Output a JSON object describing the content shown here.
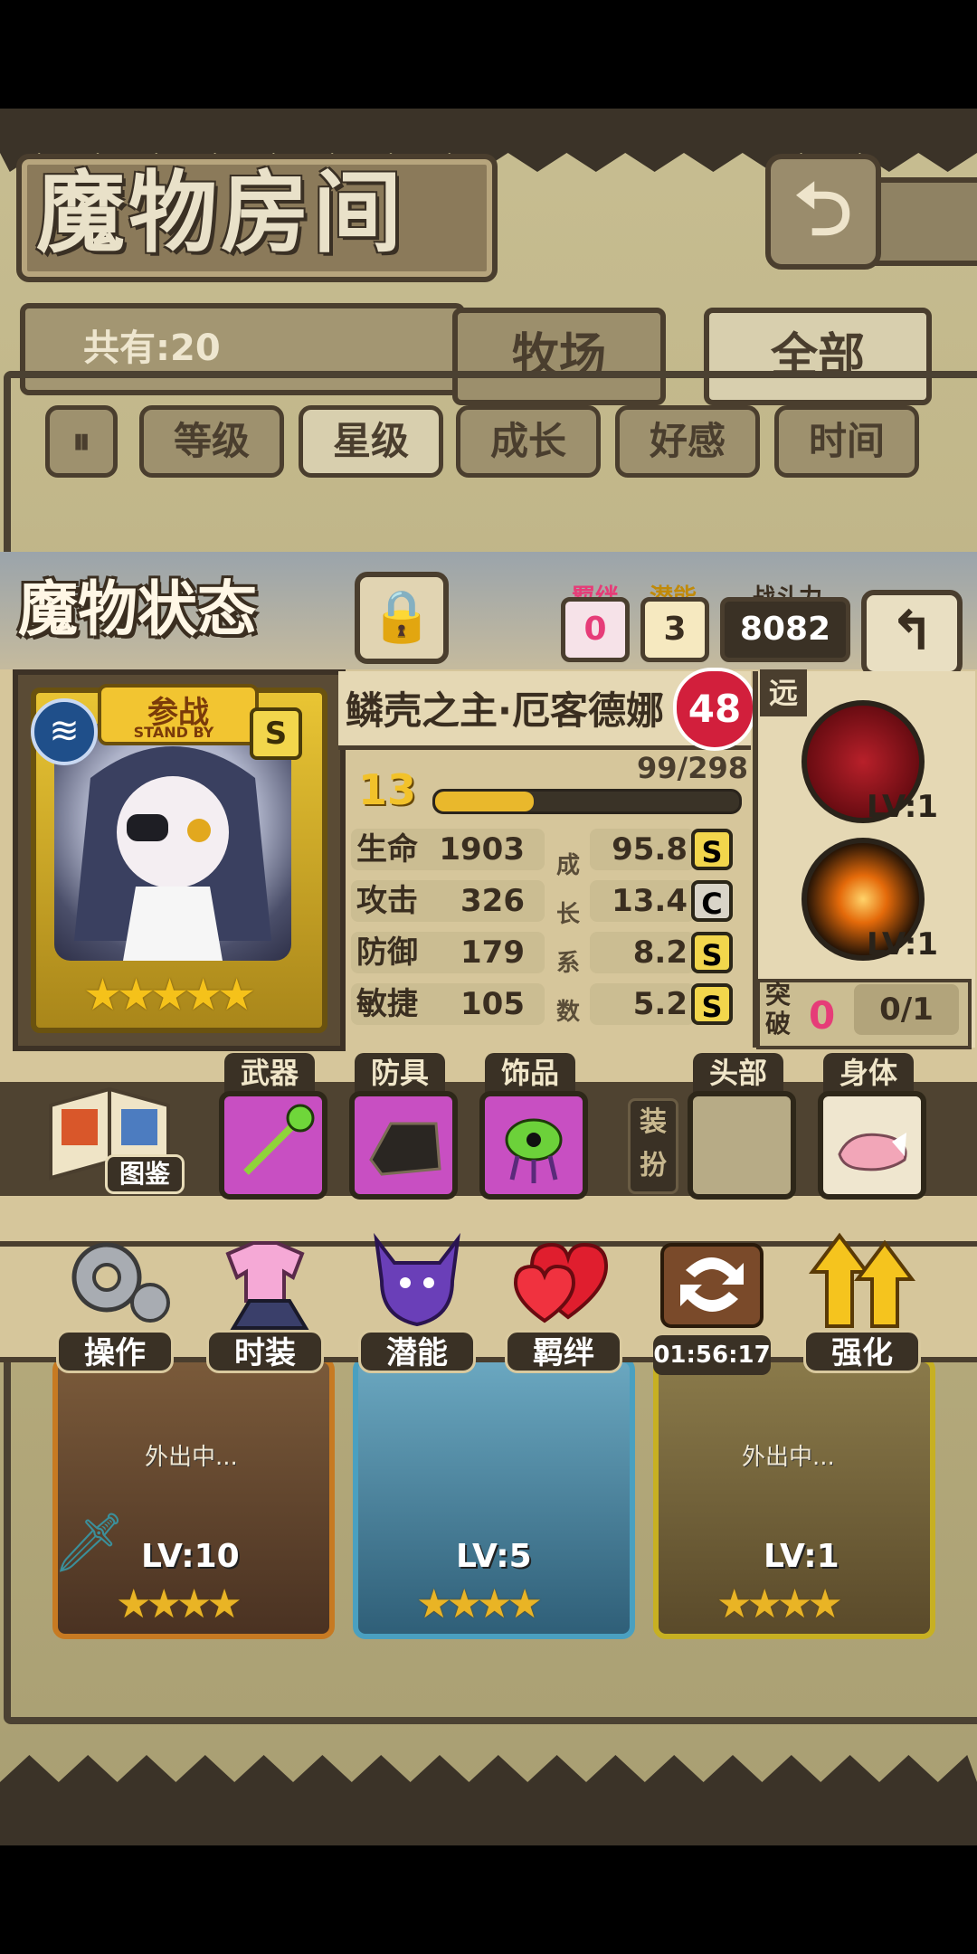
{
  "header": {
    "title": "魔物房间",
    "count_text": "共有:20",
    "tabs": [
      "牧场",
      "全部"
    ]
  },
  "sort": {
    "icon": "sort-toggle-icon",
    "buttons": [
      "等级",
      "星级",
      "成长",
      "好感",
      "时间"
    ],
    "active": "星级"
  },
  "status": {
    "title": "魔物状态",
    "bond": {
      "label": "羁绊",
      "value": "0"
    },
    "potential": {
      "label": "潜能",
      "value": "3"
    },
    "power": {
      "label": "战斗力",
      "value": "8082"
    }
  },
  "card": {
    "standby_cn": "参战",
    "standby_en": "STAND BY",
    "rank": "S",
    "stars": 5
  },
  "monster": {
    "name": "鳞壳之主·厄客德娜",
    "level": "48",
    "star_level": "13",
    "exp_text": "99/298",
    "exp_fraction": 0.33,
    "stats": [
      {
        "label": "生命",
        "value": "1903",
        "growth": "95.8",
        "grade": "S"
      },
      {
        "label": "攻击",
        "value": "326",
        "growth": "13.4",
        "grade": "C"
      },
      {
        "label": "防御",
        "value": "179",
        "growth": "8.2",
        "grade": "S"
      },
      {
        "label": "敏捷",
        "value": "105",
        "growth": "5.2",
        "grade": "S"
      }
    ],
    "growth_label": [
      "成",
      "长",
      "系",
      "数"
    ]
  },
  "skills": {
    "range": "远",
    "items": [
      {
        "icon": "serpent-skill-icon",
        "lv": "LV:1"
      },
      {
        "icon": "burst-skill-icon",
        "lv": "LV:1"
      }
    ],
    "breakthrough_label": "突破",
    "breakthrough_count": "0",
    "breakthrough_progress": "0/1"
  },
  "equipment": {
    "book_label": "图鉴",
    "slots": [
      {
        "label": "武器",
        "icon": "staff-icon"
      },
      {
        "label": "防具",
        "icon": "gauntlet-icon"
      },
      {
        "label": "饰品",
        "icon": "eye-amulet-icon"
      }
    ],
    "dress_label": "装扮",
    "dress_slots": [
      {
        "label": "头部",
        "icon": ""
      },
      {
        "label": "身体",
        "icon": "fox-tail-icon"
      }
    ]
  },
  "actions": [
    {
      "label": "操作",
      "icon": "gear-icon"
    },
    {
      "label": "时装",
      "icon": "outfit-icon"
    },
    {
      "label": "潜能",
      "icon": "potential-icon"
    },
    {
      "label": "羁绊",
      "icon": "heart-icon"
    },
    {
      "label": "",
      "icon": "swap-icon",
      "timer": "01:56:17"
    },
    {
      "label": "强化",
      "icon": "upgrade-arrow-icon"
    }
  ],
  "monster_list": [
    {
      "lv": "LV:10",
      "status": "外出中...",
      "stars": 4
    },
    {
      "lv": "LV:5",
      "status": "",
      "stars": 4
    },
    {
      "lv": "LV:1",
      "status": "外出中...",
      "stars": 4
    }
  ],
  "colors": {
    "parchment": "#c7bd91",
    "frame": "#4a3e2e",
    "accent_gold": "#f2c531",
    "grade_s": "#f2d64c",
    "grade_c": "#d9d4c8",
    "heart_red": "#d21f3c",
    "bond_pink": "#e63c78"
  }
}
